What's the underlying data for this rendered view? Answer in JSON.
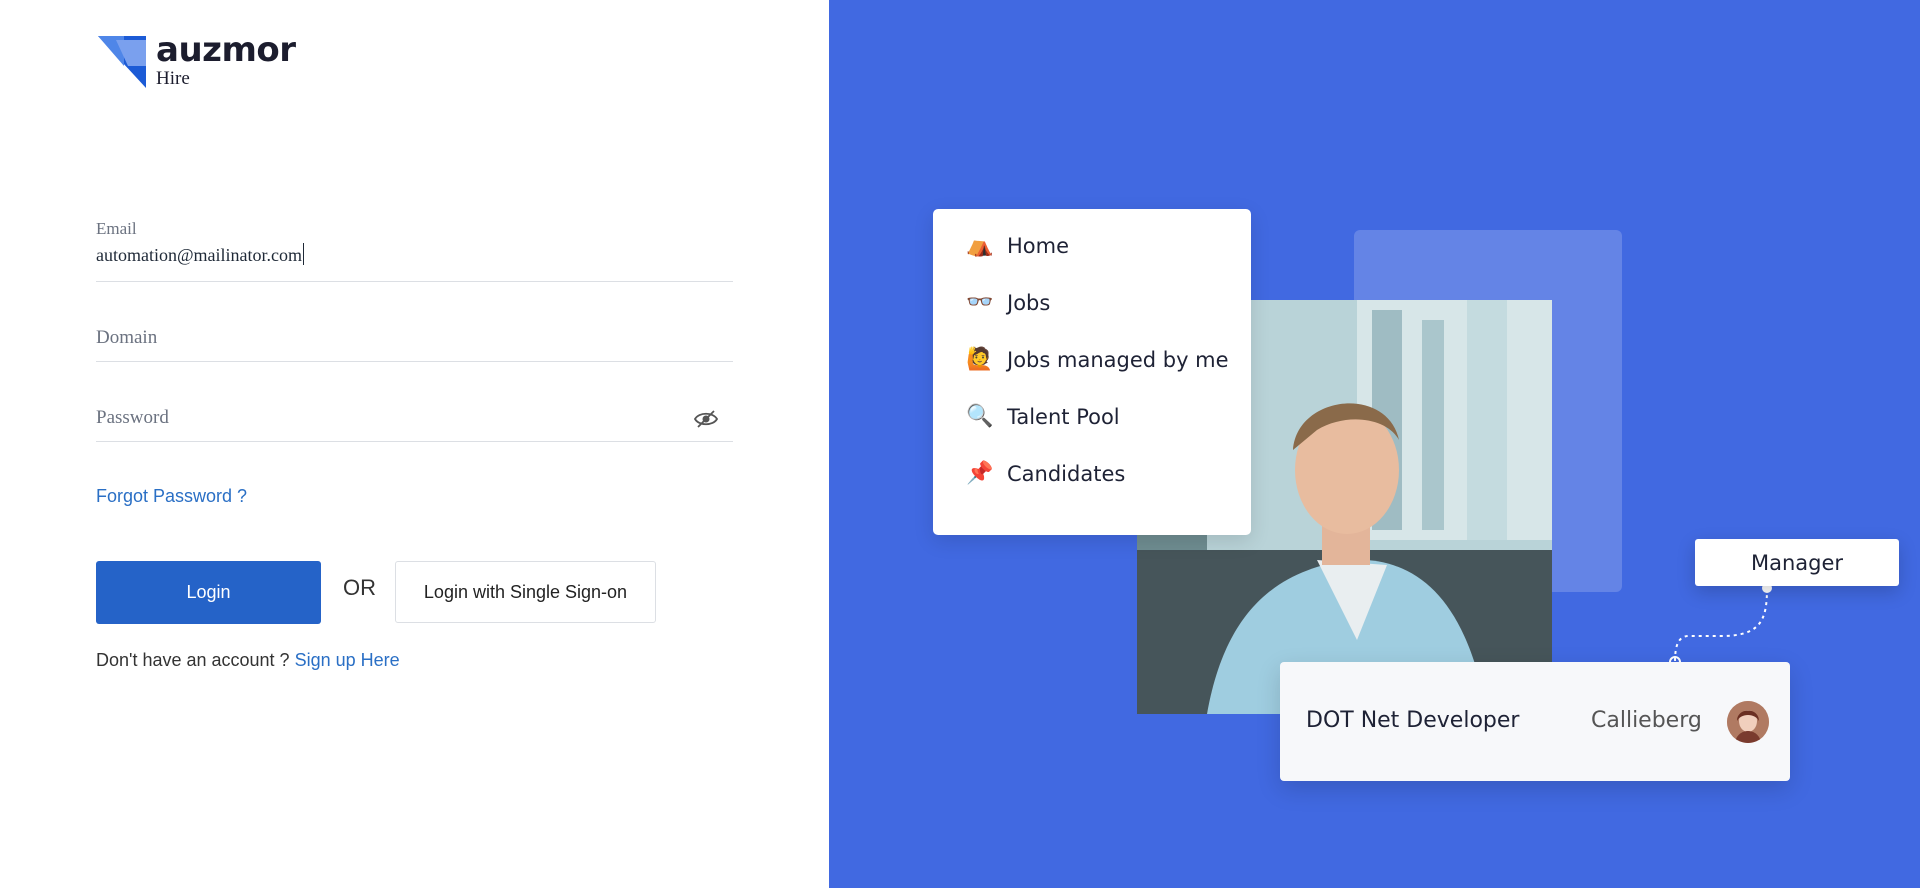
{
  "brand": {
    "name": "auzmor",
    "product": "Hire"
  },
  "login_form": {
    "email_label": "Email",
    "email_value": "automation@mailinator.com",
    "domain_placeholder": "Domain",
    "password_placeholder": "Password",
    "forgot_password": "Forgot Password ?",
    "login_button": "Login",
    "or_text": "OR",
    "sso_button": "Login with Single Sign-on",
    "signup_prompt": "Don't have an account ? ",
    "signup_link": "Sign up Here"
  },
  "illustration": {
    "menu_items": [
      {
        "icon": "tent-icon",
        "emoji": "⛺",
        "label": "Home"
      },
      {
        "icon": "glasses-icon",
        "emoji": "👓",
        "label": "Jobs"
      },
      {
        "icon": "person-raising-hand-icon",
        "emoji": "🙋",
        "label": "Jobs managed by me"
      },
      {
        "icon": "magnifier-icon",
        "emoji": "🔍",
        "label": "Talent Pool"
      },
      {
        "icon": "pushpin-icon",
        "emoji": "📌",
        "label": "Candidates"
      }
    ],
    "manager_label": "Manager",
    "job_card": {
      "title": "DOT Net Developer",
      "person": "Callieberg"
    }
  },
  "colors": {
    "panel_blue": "#4169e1",
    "primary_button": "#2563c8",
    "link": "#2a6fc5"
  }
}
